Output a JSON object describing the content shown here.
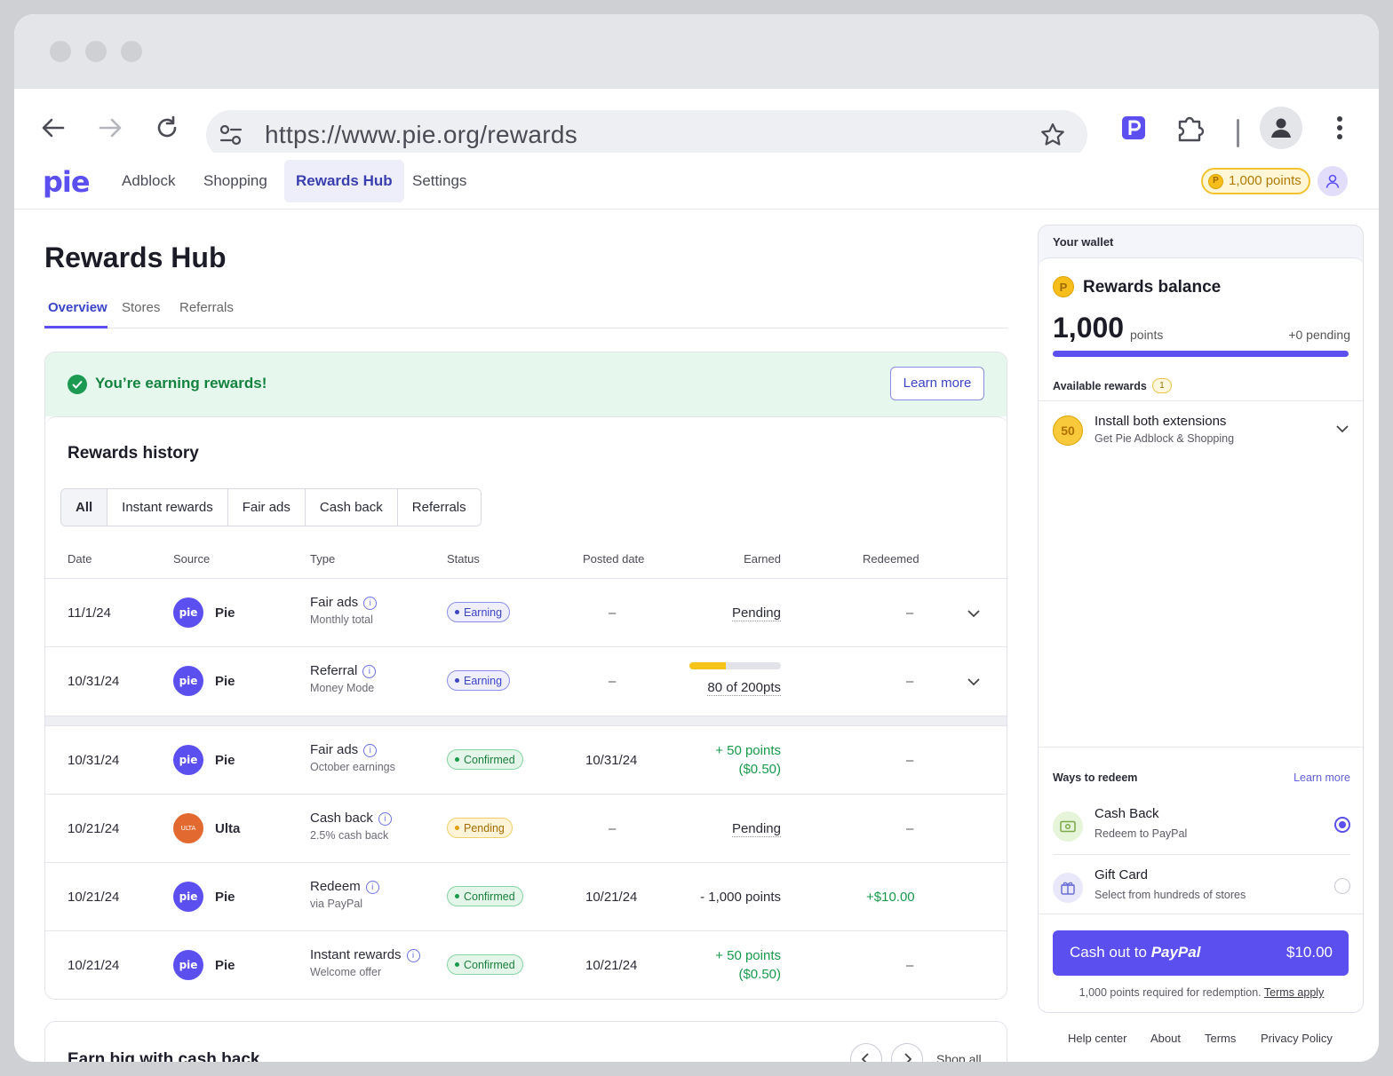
{
  "browser": {
    "url": "https://www.pie.org/rewards"
  },
  "app": {
    "logo": "pie",
    "nav": [
      {
        "label": "Adblock"
      },
      {
        "label": "Shopping"
      },
      {
        "label": "Rewards Hub"
      },
      {
        "label": "Settings"
      }
    ],
    "points_badge": "1,000 points",
    "coin_glyph": "P"
  },
  "page": {
    "title": "Rewards Hub",
    "tabs": [
      {
        "label": "Overview"
      },
      {
        "label": "Stores"
      },
      {
        "label": "Referrals"
      }
    ]
  },
  "banner": {
    "text": "You’re earning rewards!",
    "button": "Learn more"
  },
  "history": {
    "title": "Rewards history",
    "filters": [
      "All",
      "Instant rewards",
      "Fair ads",
      "Cash back",
      "Referrals"
    ],
    "columns": {
      "date": "Date",
      "source": "Source",
      "type": "Type",
      "status": "Status",
      "posted": "Posted date",
      "earned": "Earned",
      "redeemed": "Redeemed"
    },
    "rows": [
      {
        "date": "11/1/24",
        "source": "Pie",
        "source_icon": "pie",
        "type": "Fair ads",
        "type_sub": "Monthly total",
        "status": "Earning",
        "posted": "–",
        "earned": "Pending",
        "earned_sub": "",
        "redeemed": "–"
      },
      {
        "date": "10/31/24",
        "source": "Pie",
        "source_icon": "pie",
        "type": "Referral",
        "type_sub": "Money Mode",
        "status": "Earning",
        "posted": "–",
        "earned": "80 of 200pts",
        "earned_sub": "",
        "progress": 0.4,
        "redeemed": "–"
      },
      {
        "date": "10/31/24",
        "source": "Pie",
        "source_icon": "pie",
        "type": "Fair ads",
        "type_sub": "October earnings",
        "status": "Confirmed",
        "posted": "10/31/24",
        "earned": "+ 50 points",
        "earned_sub": "($0.50)",
        "redeemed": "–"
      },
      {
        "date": "10/21/24",
        "source": "Ulta",
        "source_icon": "ULTA",
        "type": "Cash back",
        "type_sub": "2.5% cash back",
        "status": "Pending",
        "posted": "–",
        "earned": "Pending",
        "earned_sub": "",
        "redeemed": "–"
      },
      {
        "date": "10/21/24",
        "source": "Pie",
        "source_icon": "pie",
        "type": "Redeem",
        "type_sub": "via PayPal",
        "status": "Confirmed",
        "posted": "10/21/24",
        "earned": "- 1,000 points",
        "earned_sub": "",
        "redeemed": "+$10.00"
      },
      {
        "date": "10/21/24",
        "source": "Pie",
        "source_icon": "pie",
        "type": "Instant rewards",
        "type_sub": "Welcome offer",
        "status": "Confirmed",
        "posted": "10/21/24",
        "earned": "+ 50 points",
        "earned_sub": "($0.50)",
        "redeemed": "–"
      }
    ]
  },
  "earn_big": {
    "title": "Earn big with cash back",
    "shop_all": "Shop all"
  },
  "wallet": {
    "header": "Your wallet",
    "balance_title": "Rewards balance",
    "points": "1,000",
    "points_unit": "points",
    "pending": "+0 pending",
    "balance_fill": 1.0,
    "available_label": "Available rewards",
    "available_count": "1",
    "reward": {
      "amount": "50",
      "title": "Install both extensions",
      "sub": "Get Pie Adblock & Shopping"
    },
    "ways_label": "Ways to redeem",
    "ways_more": "Learn more",
    "options": [
      {
        "title": "Cash Back",
        "sub": "Redeem to PayPal",
        "selected": true
      },
      {
        "title": "Gift Card",
        "sub": "Select from hundreds of stores",
        "selected": false
      }
    ],
    "cash_button_prefix": "Cash out to",
    "cash_button_brand": "PayPal",
    "cash_button_amount": "$10.00",
    "fine_print": "1,000 points required for redemption.",
    "terms": "Terms apply"
  },
  "footer": [
    "Help center",
    "About",
    "Terms",
    "Privacy Policy"
  ],
  "colors": {
    "accent": "#5b4ff0",
    "success": "#17994a",
    "warning": "#f6c318"
  }
}
